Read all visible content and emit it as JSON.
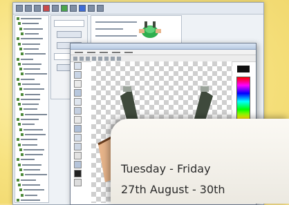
{
  "info_card": {
    "line1": "Tuesday - Friday",
    "line2": "27th August - 30th"
  },
  "colors": {
    "backdrop": "#f6e08a",
    "sprite_green": "#2fae4f",
    "sprite_dark": "#3f4a3c",
    "skin": "#e7b48a"
  },
  "icons": {
    "toolbar": [
      "tool-icon",
      "save-icon",
      "run-icon",
      "settings-icon"
    ]
  }
}
